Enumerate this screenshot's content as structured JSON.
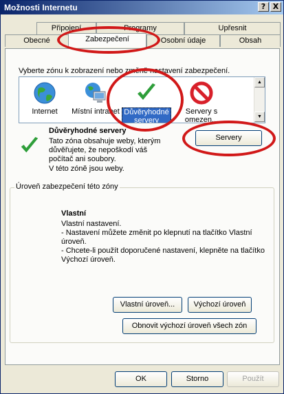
{
  "window": {
    "title": "Možnosti Internetu",
    "help_btn": "?",
    "close_btn": "X"
  },
  "tabs": {
    "row1": [
      {
        "label": "Připojení",
        "underline_index": 0
      },
      {
        "label": "Programy"
      },
      {
        "label": "Upřesnit"
      }
    ],
    "row2": [
      {
        "label": "Obecné"
      },
      {
        "label": "Zabezpečení",
        "active": true
      },
      {
        "label": "Osobní údaje"
      },
      {
        "label": "Obsah"
      }
    ]
  },
  "zones": {
    "prompt": "Vyberte zónu k zobrazení nebo změně nastavení zabezpečení.",
    "items": [
      {
        "label": "Internet",
        "icon": "globe-icon"
      },
      {
        "label": "Místní intranet",
        "icon": "intranet-computer-icon"
      },
      {
        "label_line1": "Důvěryhodné",
        "label_line2": "servery",
        "icon": "checkmark-icon",
        "selected": true
      },
      {
        "label": "Servery s omezen...",
        "icon": "restricted-icon"
      }
    ]
  },
  "zone_info": {
    "title": "Důvěryhodné servery",
    "description": "Tato zóna obsahuje weby, kterým důvěřujete, že nepoškodí váš počítač ani soubory.",
    "status": "V této zóně jsou weby.",
    "servers_button": "Servery"
  },
  "security_level": {
    "legend": "Úroveň zabezpečení této zóny",
    "title": "Vlastní",
    "line1": "Vlastní nastavení.",
    "line2": "- Nastavení můžete změnit po klepnutí na tlačítko Vlastní úroveň.",
    "line3": "- Chcete-li použít doporučené nastavení, klepněte na tlačítko Výchozí úroveň.",
    "custom_button": "Vlastní úroveň...",
    "default_button": "Výchozí úroveň",
    "reset_all_button": "Obnovit výchozí úroveň všech zón"
  },
  "footer": {
    "ok": "OK",
    "cancel": "Storno",
    "apply": "Použít"
  },
  "colors": {
    "annotation_ring": "#d11818",
    "titlebar_start": "#0a246a",
    "selection": "#316ac5"
  }
}
